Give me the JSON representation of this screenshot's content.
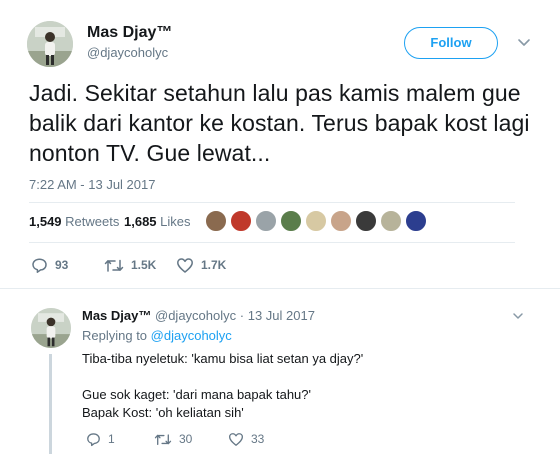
{
  "tweet": {
    "author_name": "Mas Djay™",
    "author_handle": "@djaycoholyc",
    "follow_label": "Follow",
    "text": "Jadi. Sekitar setahun lalu pas kamis malem gue balik dari kantor ke kostan. Terus bapak kost lagi nonton TV. Gue lewat...",
    "timestamp": "7:22 AM - 13 Jul 2017",
    "retweets_count": "1,549",
    "retweets_label": "Retweets",
    "likes_count": "1,685",
    "likes_label": "Likes",
    "replies_action": "93",
    "retweets_action": "1.5K",
    "likes_action": "1.7K"
  },
  "likers": [
    {
      "color": "#8a6a4f"
    },
    {
      "color": "#c0392b"
    },
    {
      "color": "#9aa3a8"
    },
    {
      "color": "#5a7d4b"
    },
    {
      "color": "#d7c9a3"
    },
    {
      "color": "#c8a48a"
    },
    {
      "color": "#3a3a3a"
    },
    {
      "color": "#b7b39a"
    },
    {
      "color": "#2c3e8f"
    }
  ],
  "reply": {
    "author_name": "Mas Djay™",
    "author_handle": "@djaycoholyc",
    "separator": "·",
    "date": "13 Jul 2017",
    "replying_to_label": "Replying to",
    "replying_to_handle": "@djaycoholyc",
    "lines": [
      "Tiba-tiba nyeletuk: 'kamu bisa liat setan ya djay?'",
      "",
      "Gue sok kaget: 'dari mana bapak tahu?'",
      "Bapak Kost: 'oh keliatan sih'"
    ],
    "replies_count": "1",
    "retweets_count": "30",
    "likes_count": "33"
  },
  "colors": {
    "accent": "#1da1f2",
    "secondary_text": "#657786",
    "divider": "#e6ecf0"
  }
}
